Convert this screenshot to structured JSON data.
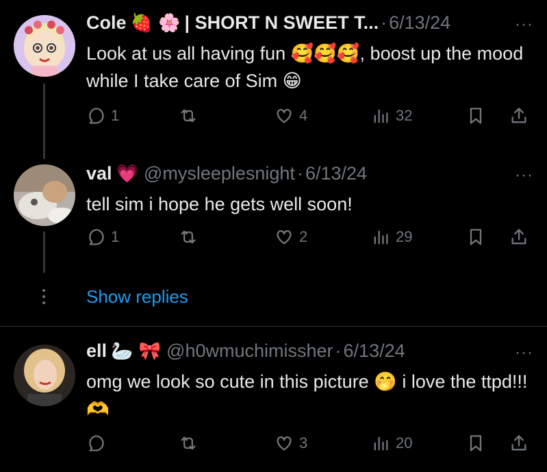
{
  "tweets": [
    {
      "name": "Cole",
      "name_emojis": "🍓 🌸",
      "handle": "| SHORT N SWEET T...",
      "sep": "·",
      "date": "6/13/24",
      "more": "···",
      "text": "Look at us all having fun 🥰🥰🥰, boost up the mood while I take care of Sim 😁",
      "replies": "1",
      "retweets": "",
      "likes": "4",
      "views": "32"
    },
    {
      "name": "val",
      "name_emojis": "💗",
      "handle": "@mysleeplesnight",
      "sep": "·",
      "date": "6/13/24",
      "more": "···",
      "text": "tell sim i hope he gets well soon!",
      "replies": "1",
      "retweets": "",
      "likes": "2",
      "views": "29"
    },
    {
      "name": "ell",
      "name_emojis": "🦢 🎀",
      "handle": "@h0wmuchimissher",
      "sep": "·",
      "date": "6/13/24",
      "more": "···",
      "text": "omg we look so cute in this picture 🤭 i love the ttpd!!! 🫶",
      "replies": "",
      "retweets": "",
      "likes": "3",
      "views": "20"
    }
  ],
  "show_replies": "Show replies",
  "colors": {
    "link": "#1d9bf0",
    "muted": "#71767b",
    "text": "#e7e9ea",
    "background": "#000000"
  }
}
